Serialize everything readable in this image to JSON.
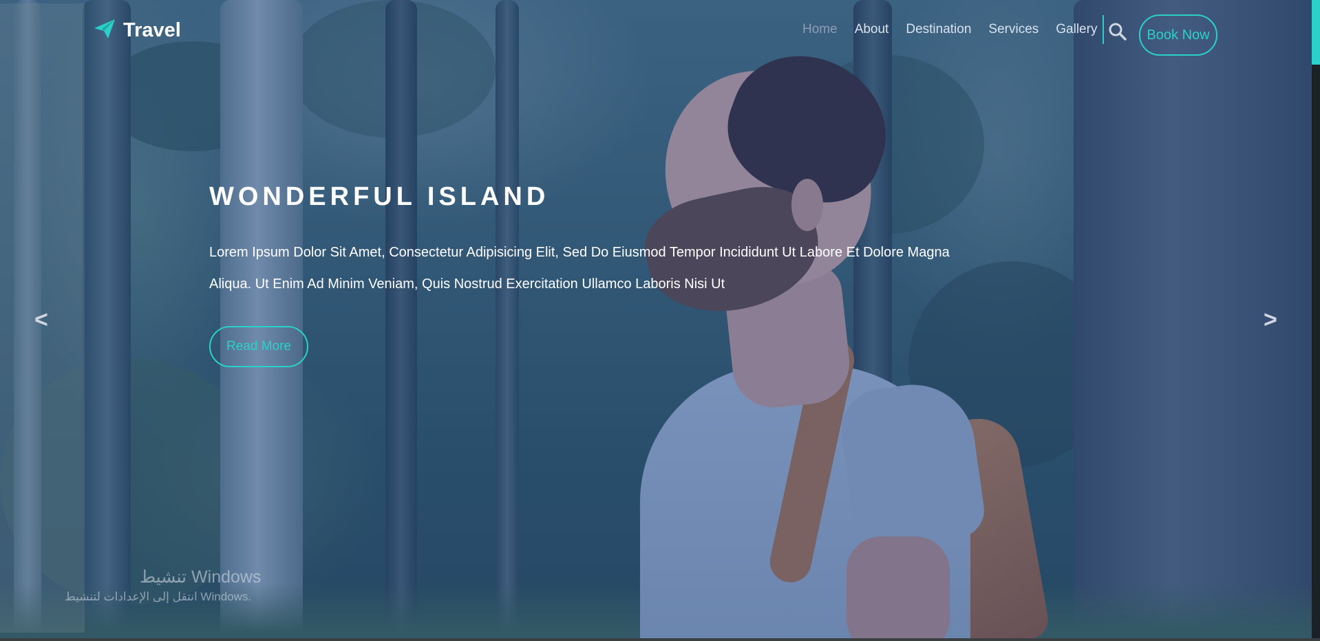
{
  "nav": {
    "brand": "Travel",
    "items": [
      {
        "label": "Home"
      },
      {
        "label": "About"
      },
      {
        "label": "Destination"
      },
      {
        "label": "Services"
      },
      {
        "label": "Gallery"
      }
    ],
    "book_label": "Book Now"
  },
  "hero": {
    "title": "WONDERFUL ISLAND",
    "description": "Lorem Ipsum Dolor Sit Amet, Consectetur Adipisicing Elit, Sed Do Eiusmod Tempor Incididunt Ut Labore Et Dolore Magna Aliqua. Ut Enim Ad Minim Veniam, Quis Nostrud Exercitation Ullamco Laboris Nisi Ut",
    "read_more_label": "Read More",
    "prev_glyph": "<",
    "next_glyph": ">"
  },
  "watermark": {
    "title": "تنشيط Windows",
    "subtitle": "انتقل إلى الإعدادات لتنشيط Windows."
  },
  "colors": {
    "accent": "#2ad1c9",
    "overlay": "#2240a0"
  },
  "icons": {
    "brand": "paper-plane-icon",
    "search": "search-icon",
    "prev": "chevron-left-icon",
    "next": "chevron-right-icon"
  }
}
